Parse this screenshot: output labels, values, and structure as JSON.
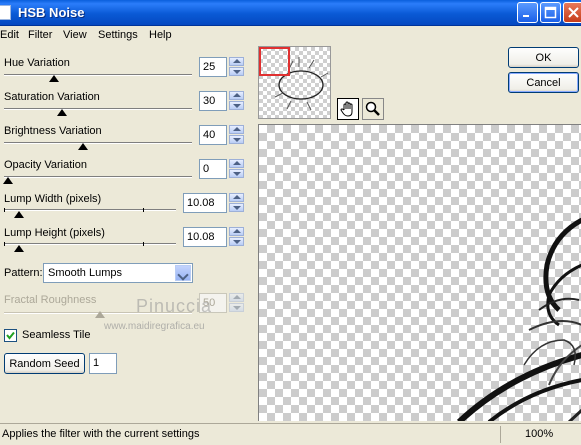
{
  "window": {
    "title": "HSB Noise"
  },
  "menu": [
    "Edit",
    "Filter",
    "View",
    "Settings",
    "Help"
  ],
  "controls": {
    "hue": {
      "label": "Hue Variation",
      "value": "25"
    },
    "saturation": {
      "label": "Saturation Variation",
      "value": "30"
    },
    "brightness": {
      "label": "Brightness Variation",
      "value": "40"
    },
    "opacity": {
      "label": "Opacity Variation",
      "value": "0"
    },
    "lump_width": {
      "label": "Lump Width (pixels)",
      "value": "10.08"
    },
    "lump_height": {
      "label": "Lump Height (pixels)",
      "value": "10.08"
    },
    "pattern": {
      "label": "Pattern:",
      "value": "Smooth Lumps"
    },
    "fractal": {
      "label": "Fractal Roughness",
      "value": "50"
    },
    "seamless": {
      "label": "Seamless Tile",
      "checked": true
    },
    "random_seed": {
      "label": "Random Seed",
      "value": "1"
    }
  },
  "buttons": {
    "ok": "OK",
    "cancel": "Cancel"
  },
  "status": {
    "text": "Applies the filter with the current settings",
    "zoom": "100%"
  },
  "watermark": {
    "line1": "Pinuccia",
    "line2": "www.maidiregrafica.eu"
  },
  "icons": {
    "pan": "hand-icon",
    "zoom": "magnifier-icon"
  }
}
